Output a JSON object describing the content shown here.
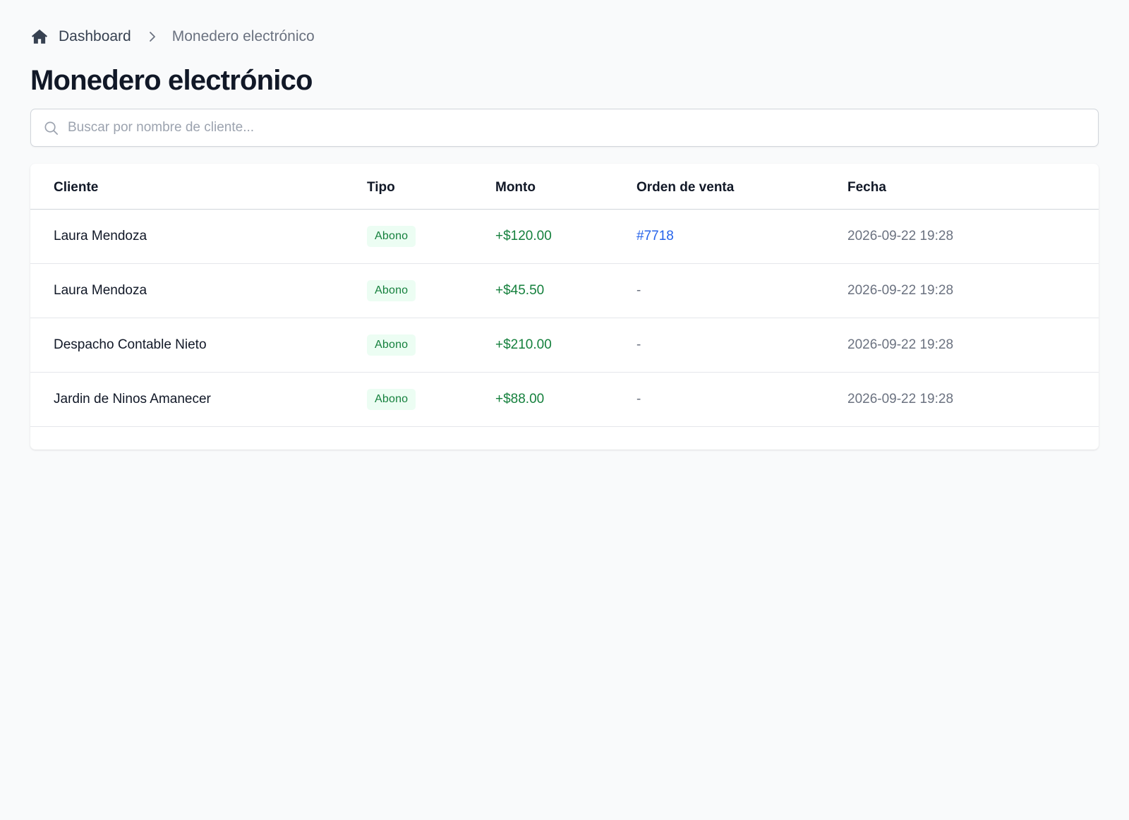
{
  "breadcrumb": {
    "home_label": "Dashboard",
    "current_label": "Monedero electrónico"
  },
  "page": {
    "title": "Monedero electrónico"
  },
  "search": {
    "placeholder": "Buscar por nombre de cliente...",
    "value": ""
  },
  "table": {
    "headers": {
      "cliente": "Cliente",
      "tipo": "Tipo",
      "monto": "Monto",
      "orden": "Orden de venta",
      "fecha": "Fecha"
    },
    "rows": [
      {
        "cliente": "Laura Mendoza",
        "tipo": "Abono",
        "monto": "+$120.00",
        "orden": "#7718",
        "fecha": "2026-09-22 19:28"
      },
      {
        "cliente": "Laura Mendoza",
        "tipo": "Abono",
        "monto": "+$45.50",
        "orden": "-",
        "fecha": "2026-09-22 19:28"
      },
      {
        "cliente": "Despacho Contable Nieto",
        "tipo": "Abono",
        "monto": "+$210.00",
        "orden": "-",
        "fecha": "2026-09-22 19:28"
      },
      {
        "cliente": "Jardin de Ninos Amanecer",
        "tipo": "Abono",
        "monto": "+$88.00",
        "orden": "-",
        "fecha": "2026-09-22 19:28"
      }
    ]
  },
  "icons": {
    "home": "home-icon",
    "chevron": "chevron-right-icon",
    "search": "search-icon"
  },
  "colors": {
    "accent_green": "#15803d",
    "badge_bg": "#ecfdf3",
    "link_blue": "#2563eb",
    "muted": "#6b7280"
  }
}
